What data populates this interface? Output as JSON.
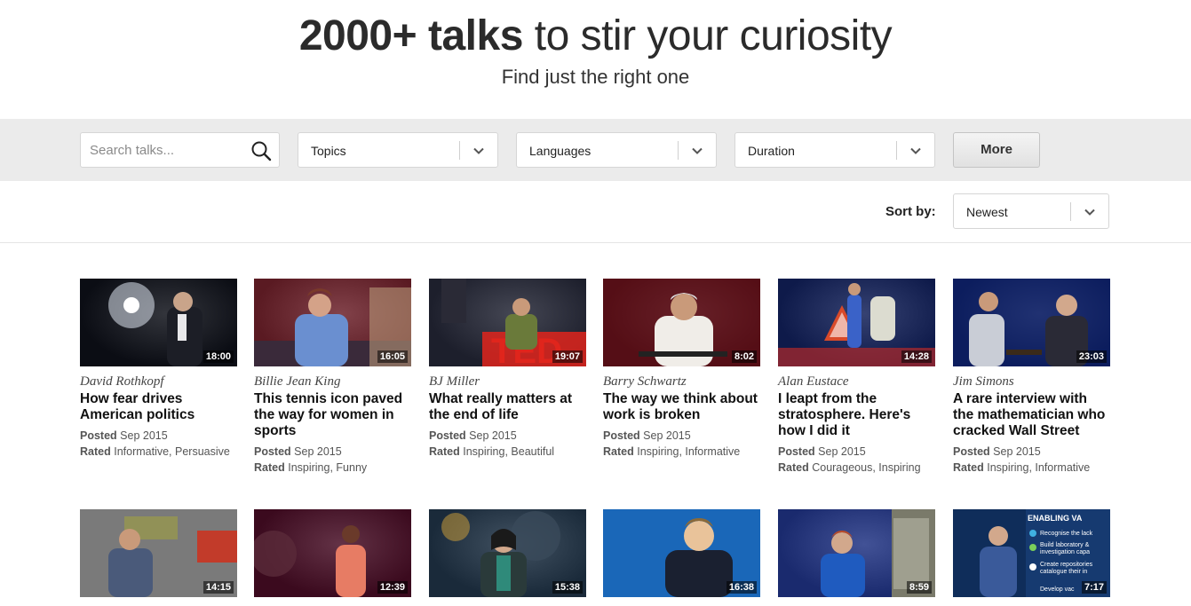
{
  "hero": {
    "title_bold": "2000+ talks",
    "title_rest": " to stir your curiosity",
    "subtitle": "Find just the right one"
  },
  "filters": {
    "search_placeholder": "Search talks...",
    "topics_label": "Topics",
    "languages_label": "Languages",
    "duration_label": "Duration",
    "more_label": "More"
  },
  "sort": {
    "label": "Sort by:",
    "value": "Newest"
  },
  "labels": {
    "posted": "Posted",
    "rated": "Rated"
  },
  "talks": [
    {
      "speaker": "David Rothkopf",
      "title": "How fear drives American politics",
      "posted": "Sep 2015",
      "rated": "Informative, Persuasive",
      "duration": "18:00",
      "bg": "#0b0d14",
      "accent": "#dfe6f0"
    },
    {
      "speaker": "Billie Jean King",
      "title": "This tennis icon paved the way for women in sports",
      "posted": "Sep 2015",
      "rated": "Inspiring, Funny",
      "duration": "16:05",
      "bg": "#5a1a22",
      "accent": "#6a8fd0"
    },
    {
      "speaker": "BJ Miller",
      "title": "What really matters at the end of life",
      "posted": "Sep 2015",
      "rated": "Inspiring, Beautiful",
      "duration": "19:07",
      "bg": "#1d1f2c",
      "accent": "#e0251c"
    },
    {
      "speaker": "Barry Schwartz",
      "title": "The way we think about work is broken",
      "posted": "Sep 2015",
      "rated": "Inspiring, Informative",
      "duration": "8:02",
      "bg": "#3a0e14",
      "accent": "#f0ede8"
    },
    {
      "speaker": "Alan Eustace",
      "title": "I leapt from the stratosphere. Here's how I did it",
      "posted": "Sep 2015",
      "rated": "Courageous, Inspiring",
      "duration": "14:28",
      "bg": "#0e1a4a",
      "accent": "#d94a2a"
    },
    {
      "speaker": "Jim Simons",
      "title": "A rare interview with the mathematician who cracked Wall Street",
      "posted": "Sep 2015",
      "rated": "Inspiring, Informative",
      "duration": "23:03",
      "bg": "#0d1d52",
      "accent": "#c9cdd6"
    },
    {
      "speaker": "",
      "title": "",
      "posted": "",
      "rated": "",
      "duration": "14:15",
      "bg": "#5a5a5a",
      "accent": "#c23b2a"
    },
    {
      "speaker": "",
      "title": "",
      "posted": "",
      "rated": "",
      "duration": "12:39",
      "bg": "#3b0a1e",
      "accent": "#e77c64"
    },
    {
      "speaker": "",
      "title": "",
      "posted": "",
      "rated": "",
      "duration": "15:38",
      "bg": "#1a2a3a",
      "accent": "#d6a437"
    },
    {
      "speaker": "",
      "title": "",
      "posted": "",
      "rated": "",
      "duration": "16:38",
      "bg": "#1a67b8",
      "accent": "#e9c39a"
    },
    {
      "speaker": "",
      "title": "",
      "posted": "",
      "rated": "",
      "duration": "8:59",
      "bg": "#1a2a6e",
      "accent": "#1f5bbf"
    },
    {
      "speaker": "",
      "title": "",
      "posted": "",
      "rated": "",
      "duration": "7:17",
      "bg": "#0f2d5a",
      "accent": "#3fb0e0"
    }
  ],
  "slide_text": {
    "heading": "ENABLING VA",
    "line1": "Recognise the lack",
    "line2": "Build laboratory &",
    "line2b": "investigation capa",
    "line3": "Create repositories",
    "line3b": "catalogue their in",
    "line4": "Develop vac"
  }
}
